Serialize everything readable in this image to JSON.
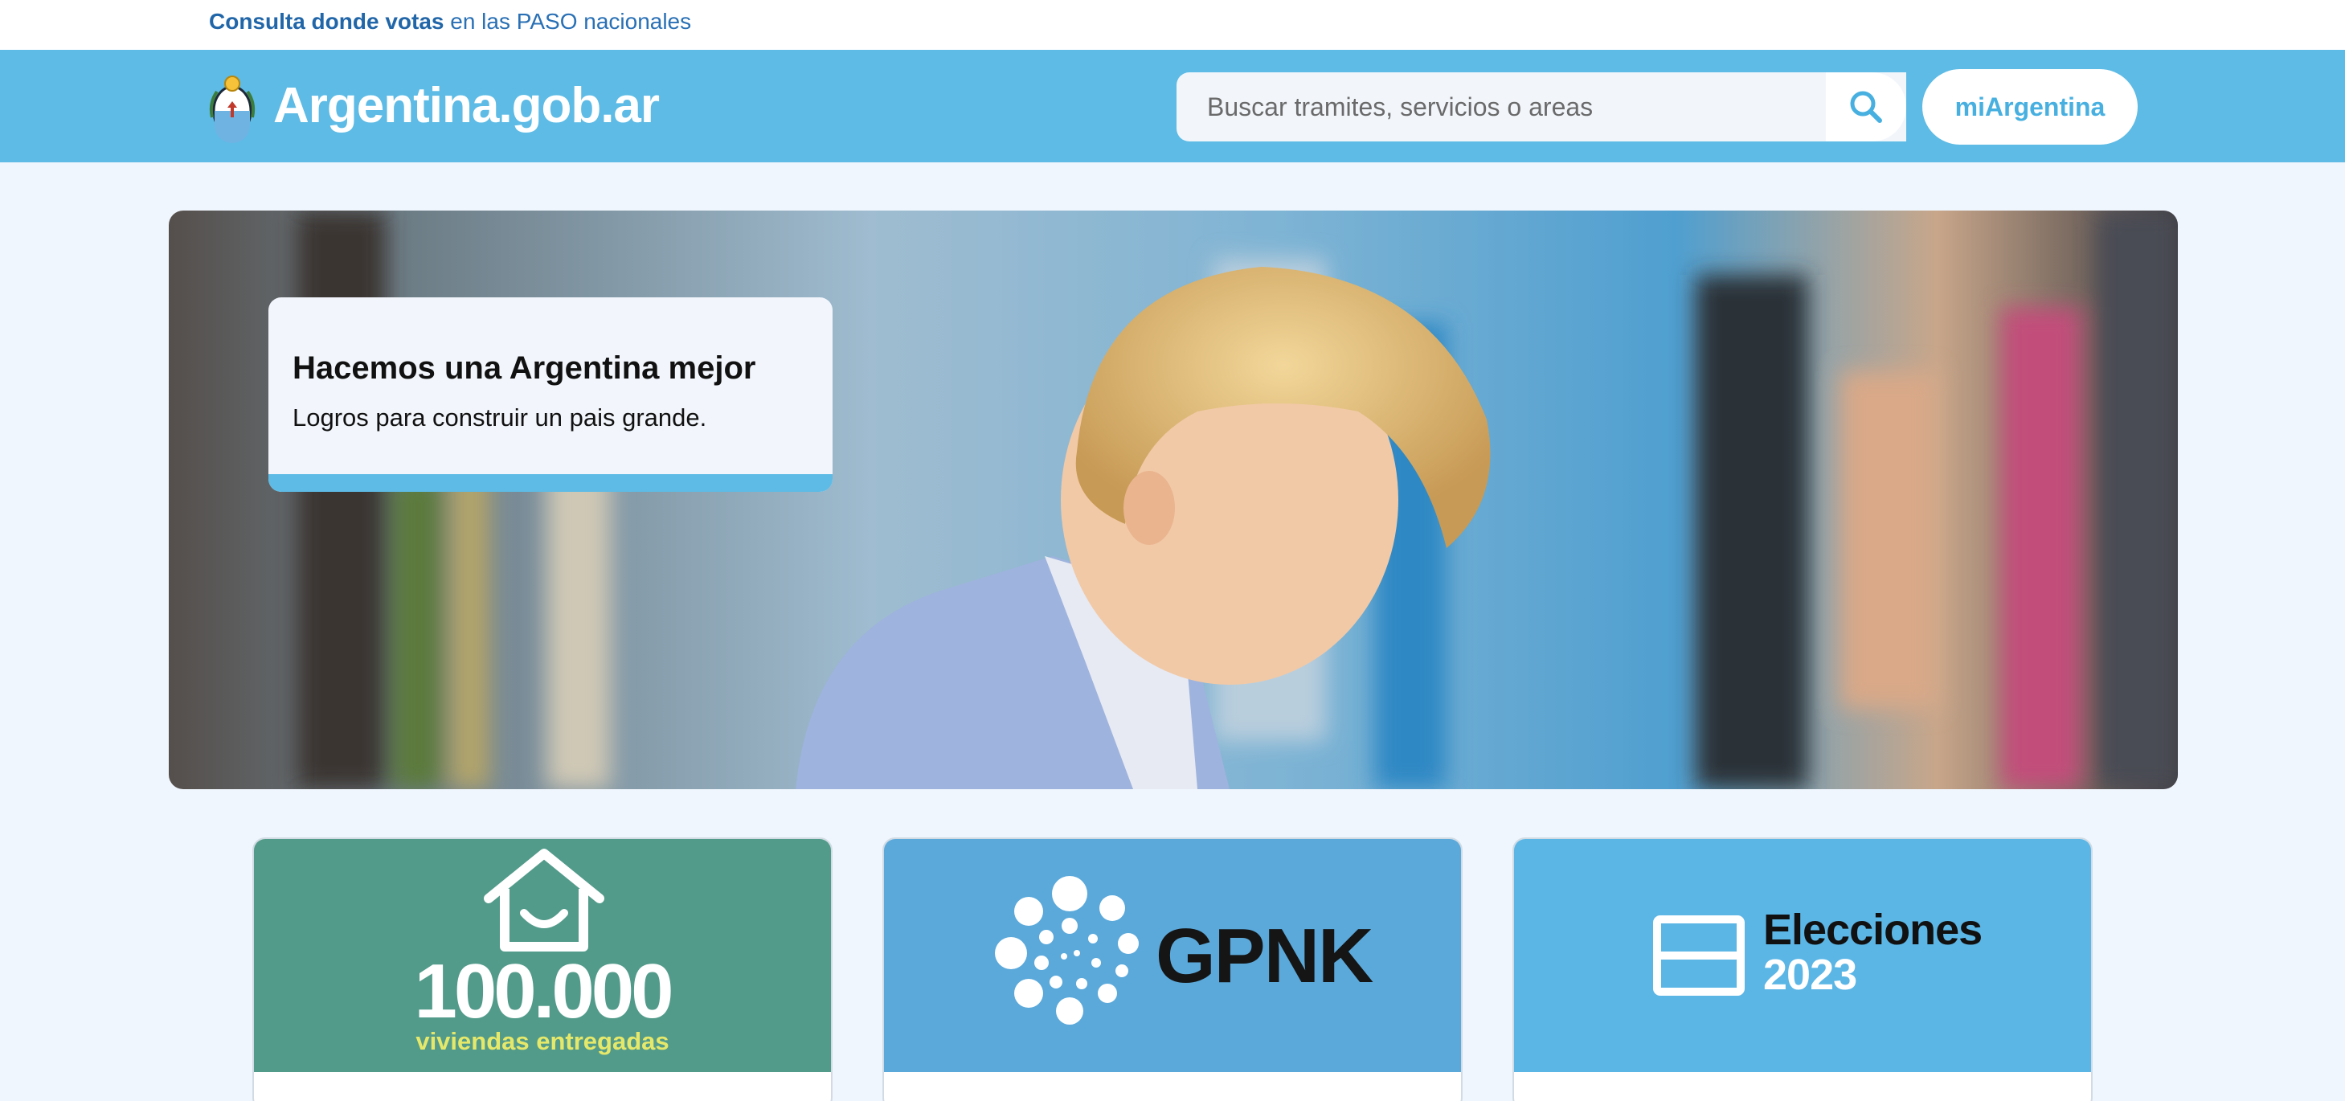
{
  "topbar": {
    "link_bold": "Consulta donde votas",
    "link_rest": " en las PASO nacionales"
  },
  "header": {
    "site_name": "Argentina.gob.ar",
    "search_placeholder": "Buscar tramites, servicios o areas",
    "search_value": "",
    "login_label": "miArgentina",
    "emblem_icon": "coat-of-arms-icon",
    "search_icon": "search-icon"
  },
  "hero": {
    "title": "Hacemos una Argentina mejor",
    "subtitle": "Logros para construir un pais grande."
  },
  "cards": [
    {
      "headline": "100.000",
      "subline": "viviendas entregadas",
      "icon": "house-smile-icon"
    },
    {
      "headline": "GPNK",
      "icon": "dots-spiral-icon"
    },
    {
      "line1": "Elecciones",
      "line2": "2023",
      "icon": "ballot-box-icon"
    }
  ],
  "colors": {
    "header_bg": "#5dbbe5",
    "page_bg": "#f0f6fd",
    "link": "#2970b5",
    "card1_bg": "#529b8a",
    "card2_bg": "#5ba9da",
    "card3_bg": "#5bb6e6",
    "accent_yellow": "#e6e86a"
  }
}
